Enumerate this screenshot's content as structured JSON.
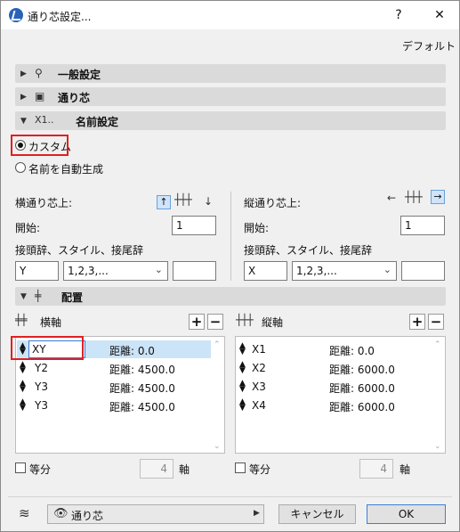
{
  "window": {
    "title": "通り芯設定...",
    "help": "?",
    "close": "✕"
  },
  "header": {
    "default_label": "デフォルト"
  },
  "sections": {
    "general": "一般設定",
    "grid": "通り芯",
    "naming": "名前設定",
    "naming_icon": "X1..",
    "placement": "配置"
  },
  "naming": {
    "custom_label": "カスタム",
    "auto_label": "名前を自動生成",
    "selected": "custom",
    "horizontal": {
      "label": "横通り芯上:",
      "start_label": "開始:",
      "start_value": "1",
      "prefix_label": "接頭辞、スタイル、接尾辞",
      "prefix": "Y",
      "style": "1,2,3,...",
      "suffix": ""
    },
    "vertical": {
      "label": "縦通り芯上:",
      "start_label": "開始:",
      "start_value": "1",
      "prefix_label": "接頭辞、スタイル、接尾辞",
      "prefix": "X",
      "style": "1,2,3,...",
      "suffix": ""
    }
  },
  "placement": {
    "horizontal": {
      "label": "横軸",
      "distance_label": "距離: ",
      "rows": [
        {
          "name": "XY",
          "distance": "0.0",
          "selected": true
        },
        {
          "name": "Y2",
          "distance": "4500.0"
        },
        {
          "name": "Y3",
          "distance": "4500.0"
        },
        {
          "name": "Y3",
          "distance": "4500.0"
        }
      ],
      "equal_label": "等分",
      "count": "4",
      "axis_label": "軸"
    },
    "vertical": {
      "label": "縦軸",
      "distance_label": "距離: ",
      "rows": [
        {
          "name": "X1",
          "distance": "0.0"
        },
        {
          "name": "X2",
          "distance": "6000.0"
        },
        {
          "name": "X3",
          "distance": "6000.0"
        },
        {
          "name": "X4",
          "distance": "6000.0"
        }
      ],
      "equal_label": "等分",
      "count": "4",
      "axis_label": "軸"
    }
  },
  "footer": {
    "layer": "通り芯",
    "cancel": "キャンセル",
    "ok": "OK"
  },
  "colors": {
    "highlight": "#e02020",
    "selection": "#cce4f7",
    "accent": "#3c7fd7"
  }
}
